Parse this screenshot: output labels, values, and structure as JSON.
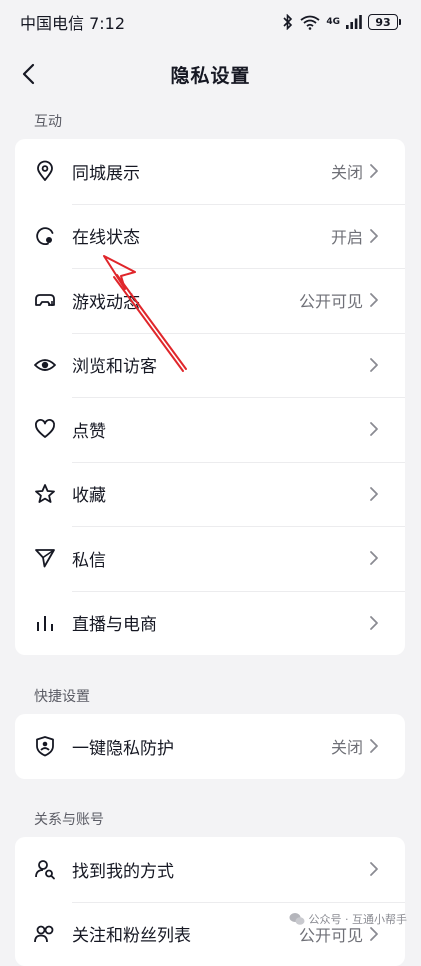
{
  "status_bar": {
    "carrier_time": "中国电信 7:12",
    "network": "4G",
    "battery": "93"
  },
  "header": {
    "title": "隐私设置"
  },
  "sections": [
    {
      "label": "互动",
      "items": [
        {
          "icon": "location-pin-icon",
          "label": "同城展示",
          "value": "关闭"
        },
        {
          "icon": "online-status-icon",
          "label": "在线状态",
          "value": "开启"
        },
        {
          "icon": "gamepad-icon",
          "label": "游戏动态",
          "value": "公开可见"
        },
        {
          "icon": "eye-icon",
          "label": "浏览和访客",
          "value": ""
        },
        {
          "icon": "heart-icon",
          "label": "点赞",
          "value": ""
        },
        {
          "icon": "star-icon",
          "label": "收藏",
          "value": ""
        },
        {
          "icon": "send-icon",
          "label": "私信",
          "value": ""
        },
        {
          "icon": "live-bars-icon",
          "label": "直播与电商",
          "value": ""
        }
      ]
    },
    {
      "label": "快捷设置",
      "items": [
        {
          "icon": "shield-user-icon",
          "label": "一键隐私防护",
          "value": "关闭"
        }
      ]
    },
    {
      "label": "关系与账号",
      "items": [
        {
          "icon": "find-user-icon",
          "label": "找到我的方式",
          "value": ""
        },
        {
          "icon": "followers-icon",
          "label": "关注和粉丝列表",
          "value": "公开可见"
        }
      ]
    }
  ],
  "watermark": {
    "text": "公众号 · 互通小帮手"
  },
  "colors": {
    "background": "#f3f3f5",
    "card": "#ffffff",
    "annotation": "#e0262b",
    "text": "#161823",
    "secondary": "#6f7077"
  }
}
